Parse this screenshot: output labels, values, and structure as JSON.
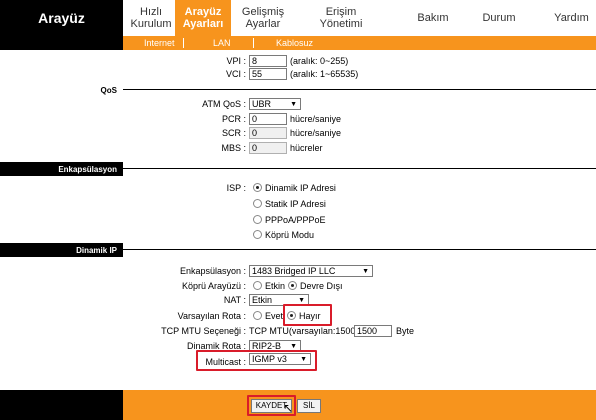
{
  "app": {
    "title": "Arayüz"
  },
  "nav": {
    "tabs": [
      {
        "line1": "Hızlı",
        "line2": "Kurulum"
      },
      {
        "line1": "Arayüz",
        "line2": "Ayarları"
      },
      {
        "line1": "Gelişmiş",
        "line2": "Ayarlar"
      },
      {
        "line1": "Erişim",
        "line2": "Yönetimi"
      },
      {
        "line1": "Bakım",
        "line2": ""
      },
      {
        "line1": "Durum",
        "line2": ""
      },
      {
        "line1": "Yardım",
        "line2": ""
      }
    ],
    "active_tab": 1,
    "subtabs": [
      "Internet",
      "LAN",
      "Kablosuz"
    ]
  },
  "atm": {
    "vpi_label": "VPI :",
    "vpi_value": "8",
    "vpi_range": "(aralık: 0~255)",
    "vci_label": "VCI :",
    "vci_value": "55",
    "vci_range": "(aralık: 1~65535)"
  },
  "qos": {
    "section": "QoS",
    "atm_qos_label": "ATM QoS :",
    "atm_qos_value": "UBR",
    "pcr_label": "PCR :",
    "pcr_value": "0",
    "pcr_unit": "hücre/saniye",
    "scr_label": "SCR :",
    "scr_value": "0",
    "scr_unit": "hücre/saniye",
    "mbs_label": "MBS :",
    "mbs_value": "0",
    "mbs_unit": "hücreler"
  },
  "encap": {
    "section": "Enkapsülasyon",
    "isp_label": "ISP :",
    "options": [
      "Dinamik IP Adresi",
      "Statik IP Adresi",
      "PPPoA/PPPoE",
      "Köprü Modu"
    ],
    "selected": 0
  },
  "dynamic": {
    "section": "Dinamik IP",
    "encap_label": "Enkapsülasyon :",
    "encap_value": "1483 Bridged IP LLC",
    "bridge_label": "Köprü Arayüzü :",
    "bridge_on": "Etkin",
    "bridge_off": "Devre Dışı",
    "nat_label": "NAT :",
    "nat_value": "Etkin",
    "route_label": "Varsayılan Rota :",
    "route_yes": "Evet",
    "route_no": "Hayır",
    "mtu_label": "TCP MTU Seçeneği :",
    "mtu_text": "TCP MTU(varsayılan:1500)",
    "mtu_value": "1500",
    "mtu_unit": "Byte",
    "dyn_route_label": "Dinamik Rota :",
    "dyn_route_value": "RIP2-B",
    "multicast_label": "Multicast :",
    "multicast_value": "IGMP v3"
  },
  "footer": {
    "save_label": "KAYDET",
    "delete_label": "SİL"
  },
  "colors": {
    "accent": "#f7941d",
    "highlight": "#d91c2a",
    "header": "#000000"
  }
}
